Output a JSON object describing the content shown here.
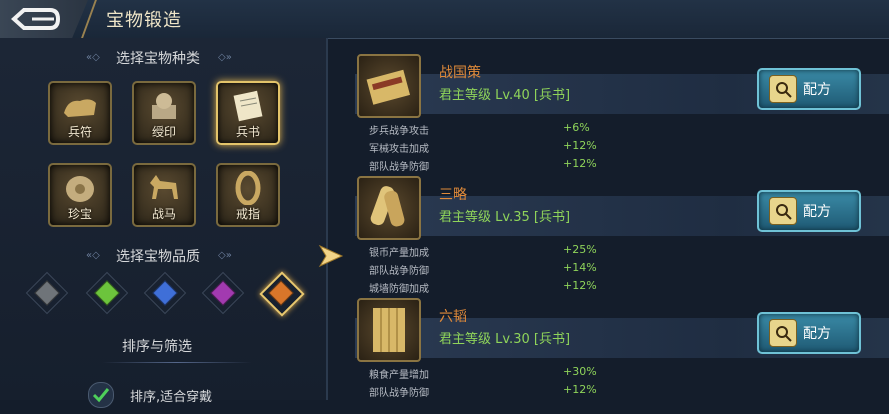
{
  "header": {
    "title": "宝物锻造"
  },
  "left": {
    "category_title": "选择宝物种类",
    "categories": [
      {
        "label": "兵符",
        "icon": "tiger-tally-icon"
      },
      {
        "label": "绶印",
        "icon": "seal-icon"
      },
      {
        "label": "兵书",
        "icon": "war-book-icon",
        "selected": true
      },
      {
        "label": "珍宝",
        "icon": "treasure-icon"
      },
      {
        "label": "战马",
        "icon": "warhorse-icon"
      },
      {
        "label": "戒指",
        "icon": "ring-icon"
      }
    ],
    "quality_title": "选择宝物品质",
    "qualities": [
      {
        "color": "#6f7479"
      },
      {
        "color": "#6cc43c"
      },
      {
        "color": "#3f6fd8"
      },
      {
        "color": "#a23ab0"
      },
      {
        "color": "#d9762a",
        "selected": true
      }
    ],
    "sort_title": "排序与筛选",
    "filter_label": "排序,适合穿戴"
  },
  "items": [
    {
      "name": "战国策",
      "level": "君主等级 Lv.40 [兵书]",
      "formula_label": "配方",
      "attrs": [
        {
          "name": "步兵战争攻击",
          "value": "+6%"
        },
        {
          "name": "军械攻击加成",
          "value": "+12%"
        },
        {
          "name": "部队战争防御",
          "value": "+12%"
        }
      ]
    },
    {
      "name": "三略",
      "level": "君主等级 Lv.35 [兵书]",
      "formula_label": "配方",
      "attrs": [
        {
          "name": "银币产量加成",
          "value": "+25%"
        },
        {
          "name": "部队战争防御",
          "value": "+14%"
        },
        {
          "name": "城墙防御加成",
          "value": "+12%"
        }
      ]
    },
    {
      "name": "六韬",
      "level": "君主等级 Lv.30 [兵书]",
      "formula_label": "配方",
      "attrs": [
        {
          "name": "粮食产量增加",
          "value": "+30%"
        },
        {
          "name": "部队战争防御",
          "value": "+12%"
        }
      ]
    }
  ],
  "colors": {
    "accent_gold": "#e3c46a",
    "name_orange": "#e08a3a",
    "value_green": "#8fd45a"
  }
}
